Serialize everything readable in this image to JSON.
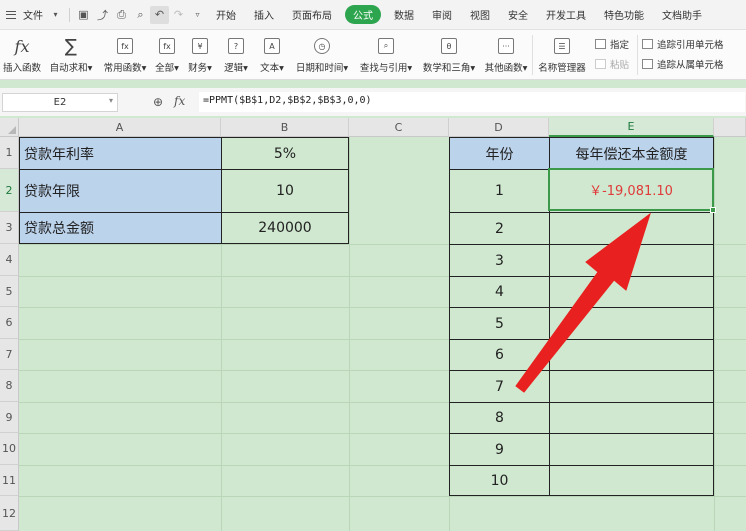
{
  "menubar": {
    "file": "文件",
    "tabs": [
      "开始",
      "插入",
      "页面布局",
      "公式",
      "数据",
      "审阅",
      "视图",
      "安全",
      "开发工具",
      "特色功能",
      "文档助手"
    ],
    "active_tab": "公式"
  },
  "ribbon": {
    "insert_function": "插入函数",
    "autosum": "自动求和",
    "common_functions": "常用函数",
    "all": "全部",
    "financial": "财务",
    "logical": "逻辑",
    "text": "文本",
    "datetime": "日期和时间",
    "lookup": "查找与引用",
    "math": "数学和三角",
    "other": "其他函数",
    "name_manager": "名称管理器",
    "specify": "指定",
    "paste": "粘贴",
    "trace_precedents": "追踪引用单元格",
    "trace_dependents": "追踪从属单元格"
  },
  "formula_bar": {
    "cell_ref": "E2",
    "fx": "fx",
    "formula": "=PPMT($B$1,D2,$B$2,$B$3,0,0)"
  },
  "columns": [
    "A",
    "B",
    "C",
    "D",
    "E"
  ],
  "rows": [
    "1",
    "2",
    "3",
    "4",
    "5",
    "6",
    "7",
    "8",
    "9",
    "10",
    "11",
    "12"
  ],
  "loan_table": {
    "r1_label": "贷款年利率",
    "r1_value": "5%",
    "r2_label": "贷款年限",
    "r2_value": "10",
    "r3_label": "贷款总金额",
    "r3_value": "240000"
  },
  "payment_table": {
    "header_year": "年份",
    "header_amount": "每年偿还本金额度",
    "years": [
      "1",
      "2",
      "3",
      "4",
      "5",
      "6",
      "7",
      "8",
      "9",
      "10"
    ],
    "e2_value": "￥-19,081.10"
  },
  "colors": {
    "accent": "#2da44e",
    "sheet_bg": "#cfe8cf",
    "label_bg": "#bcd3ec",
    "arrow": "#e8201f",
    "value_red": "#e03a3a"
  }
}
